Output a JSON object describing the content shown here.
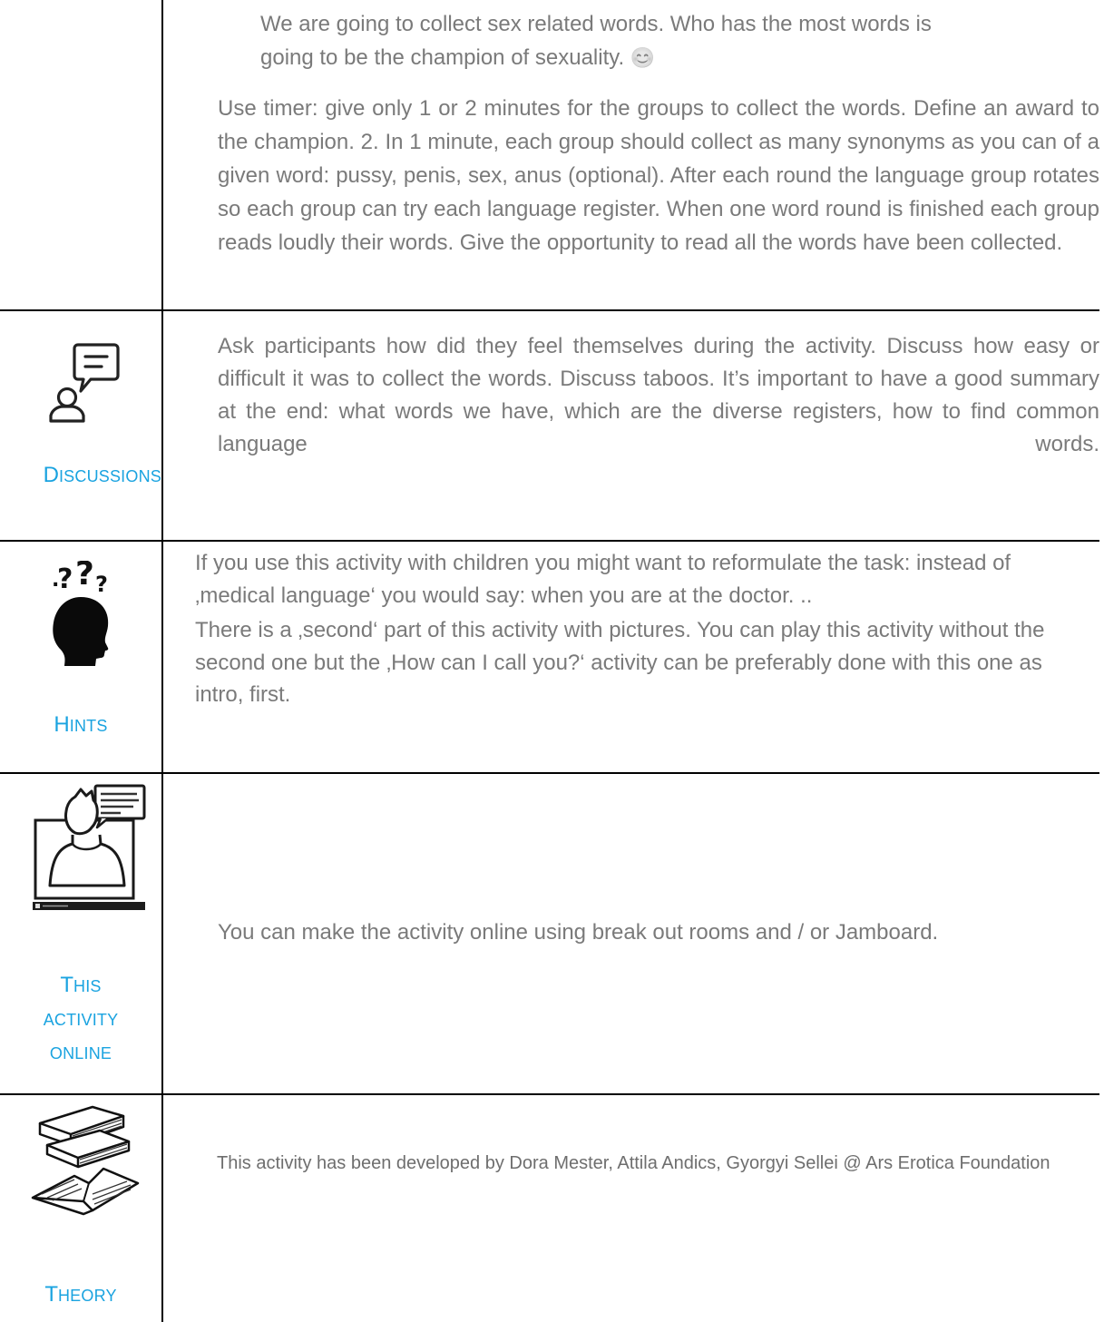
{
  "intro": {
    "line1": "We are going to collect sex related words. Who has the most words is",
    "line2": "going to be the champion of sexuality.",
    "emoji": "😊",
    "paragraph": "Use timer: give only 1 or 2 minutes for the groups to collect the words. Define an award to the champion. 2. In 1 minute, each group should collect as many synonyms as you can of a given word: pussy, penis, sex, anus (optional). After each round the language group rotates so each group can try each language register. When one word round is finished each group reads loudly their words. Give the opportunity to read all the words have been collected."
  },
  "sections": {
    "discussions": {
      "label_cap": "D",
      "label_rest": "ISCUSSIONS",
      "icon": "chat-person-icon",
      "text": "Ask participants how did they feel themselves during the activity. Discuss how easy or difficult it was to collect the words. Discuss taboos. It’s important to have a good summary at the end: what words we have, which are the diverse registers, how to find common language words."
    },
    "hints": {
      "label_cap": "H",
      "label_rest": "INTS",
      "icon": "thinking-head-icon",
      "text1": "If you use this activity with children you might want to reformulate the task: instead of ‚medical language‘ you would say: when you are at the doctor. ..",
      "text2": "There is a ‚second‘ part of this activity with pictures. You can play this activity without the second one but the ‚How can I call you?‘ activity can be preferably done with this one as intro, first."
    },
    "online": {
      "label_cap": "T",
      "label_line1": "HIS",
      "label_line2": "ACTIVITY",
      "label_line3": "ONLINE",
      "icon": "online-meeting-icon",
      "text": "You can make the activity online using break out rooms and / or Jamboard."
    },
    "theory": {
      "label_cap": "T",
      "label_rest": "HEORY",
      "icon": "books-icon",
      "text": "This activity has been developed by Dora Mester, Attila Andics, Gyorgyi Sellei @ Ars Erotica Foundation"
    }
  }
}
